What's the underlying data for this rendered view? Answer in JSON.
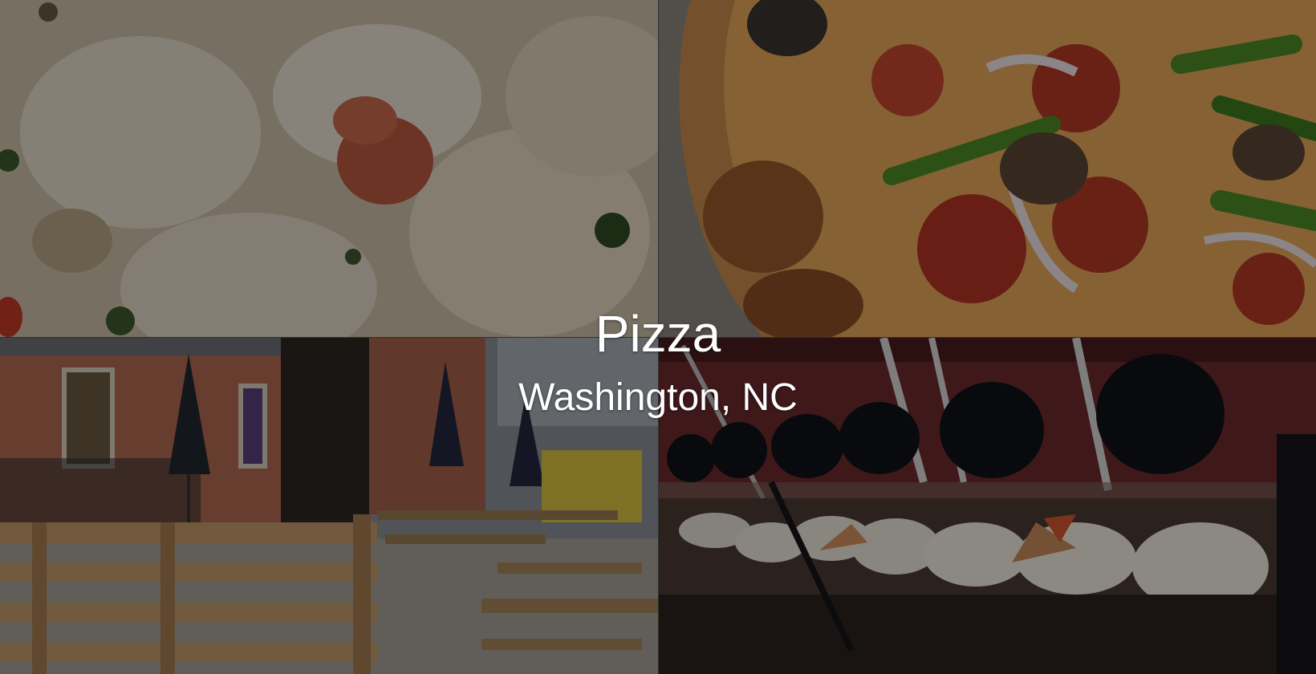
{
  "banner": {
    "title": "Pizza",
    "subtitle": "Washington, NC"
  },
  "photos": [
    {
      "name": "ravioli-photo",
      "subject": "ravioli in cream sauce"
    },
    {
      "name": "pizza-photo",
      "subject": "supreme pizza"
    },
    {
      "name": "patio-photo",
      "subject": "outdoor patio with picnic tables"
    },
    {
      "name": "buffet-photo",
      "subject": "pizza buffet under heat lamps"
    }
  ],
  "colors": {
    "caption_text": "#ffffff",
    "overlay": "rgba(0,0,0,0.42)"
  }
}
